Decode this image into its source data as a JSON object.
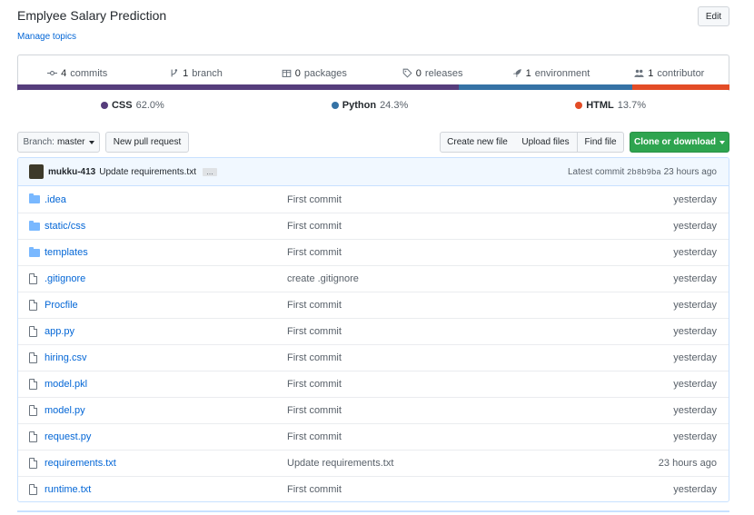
{
  "repo": {
    "title": "Emplyee Salary Prediction",
    "manage_topics": "Manage topics",
    "edit_label": "Edit"
  },
  "summary": [
    {
      "count": "4",
      "label": "commits",
      "icon": "commit-icon"
    },
    {
      "count": "1",
      "label": "branch",
      "icon": "branch-icon"
    },
    {
      "count": "0",
      "label": "packages",
      "icon": "package-icon"
    },
    {
      "count": "0",
      "label": "releases",
      "icon": "tag-icon"
    },
    {
      "count": "1",
      "label": "environment",
      "icon": "rocket-icon"
    },
    {
      "count": "1",
      "label": "contributor",
      "icon": "people-icon"
    }
  ],
  "languages": [
    {
      "name": "CSS",
      "percent": "62.0%",
      "color": "#563d7c",
      "share": 62.0
    },
    {
      "name": "Python",
      "percent": "24.3%",
      "color": "#3572A5",
      "share": 24.3
    },
    {
      "name": "HTML",
      "percent": "13.7%",
      "color": "#e34c26",
      "share": 13.7
    }
  ],
  "toolbar": {
    "branch_prefix": "Branch:",
    "branch_name": "master",
    "new_pr": "New pull request",
    "create_file": "Create new file",
    "upload_files": "Upload files",
    "find_file": "Find file",
    "clone": "Clone or download"
  },
  "latest_commit": {
    "author": "mukku-413",
    "message": "Update requirements.txt",
    "ellipsis": "…",
    "prefix": "Latest commit",
    "sha": "2b8b9ba",
    "time": "23 hours ago"
  },
  "files": [
    {
      "name": ".idea",
      "type": "dir",
      "message": "First commit",
      "age": "yesterday"
    },
    {
      "name": "static/css",
      "type": "dir",
      "message": "First commit",
      "age": "yesterday"
    },
    {
      "name": "templates",
      "type": "dir",
      "message": "First commit",
      "age": "yesterday"
    },
    {
      "name": ".gitignore",
      "type": "file",
      "message": "create .gitignore",
      "age": "yesterday"
    },
    {
      "name": "Procfile",
      "type": "file",
      "message": "First commit",
      "age": "yesterday"
    },
    {
      "name": "app.py",
      "type": "file",
      "message": "First commit",
      "age": "yesterday"
    },
    {
      "name": "hiring.csv",
      "type": "file",
      "message": "First commit",
      "age": "yesterday"
    },
    {
      "name": "model.pkl",
      "type": "file",
      "message": "First commit",
      "age": "yesterday"
    },
    {
      "name": "model.py",
      "type": "file",
      "message": "First commit",
      "age": "yesterday"
    },
    {
      "name": "request.py",
      "type": "file",
      "message": "First commit",
      "age": "yesterday"
    },
    {
      "name": "requirements.txt",
      "type": "file",
      "message": "Update requirements.txt",
      "age": "23 hours ago"
    },
    {
      "name": "runtime.txt",
      "type": "file",
      "message": "First commit",
      "age": "yesterday"
    }
  ]
}
